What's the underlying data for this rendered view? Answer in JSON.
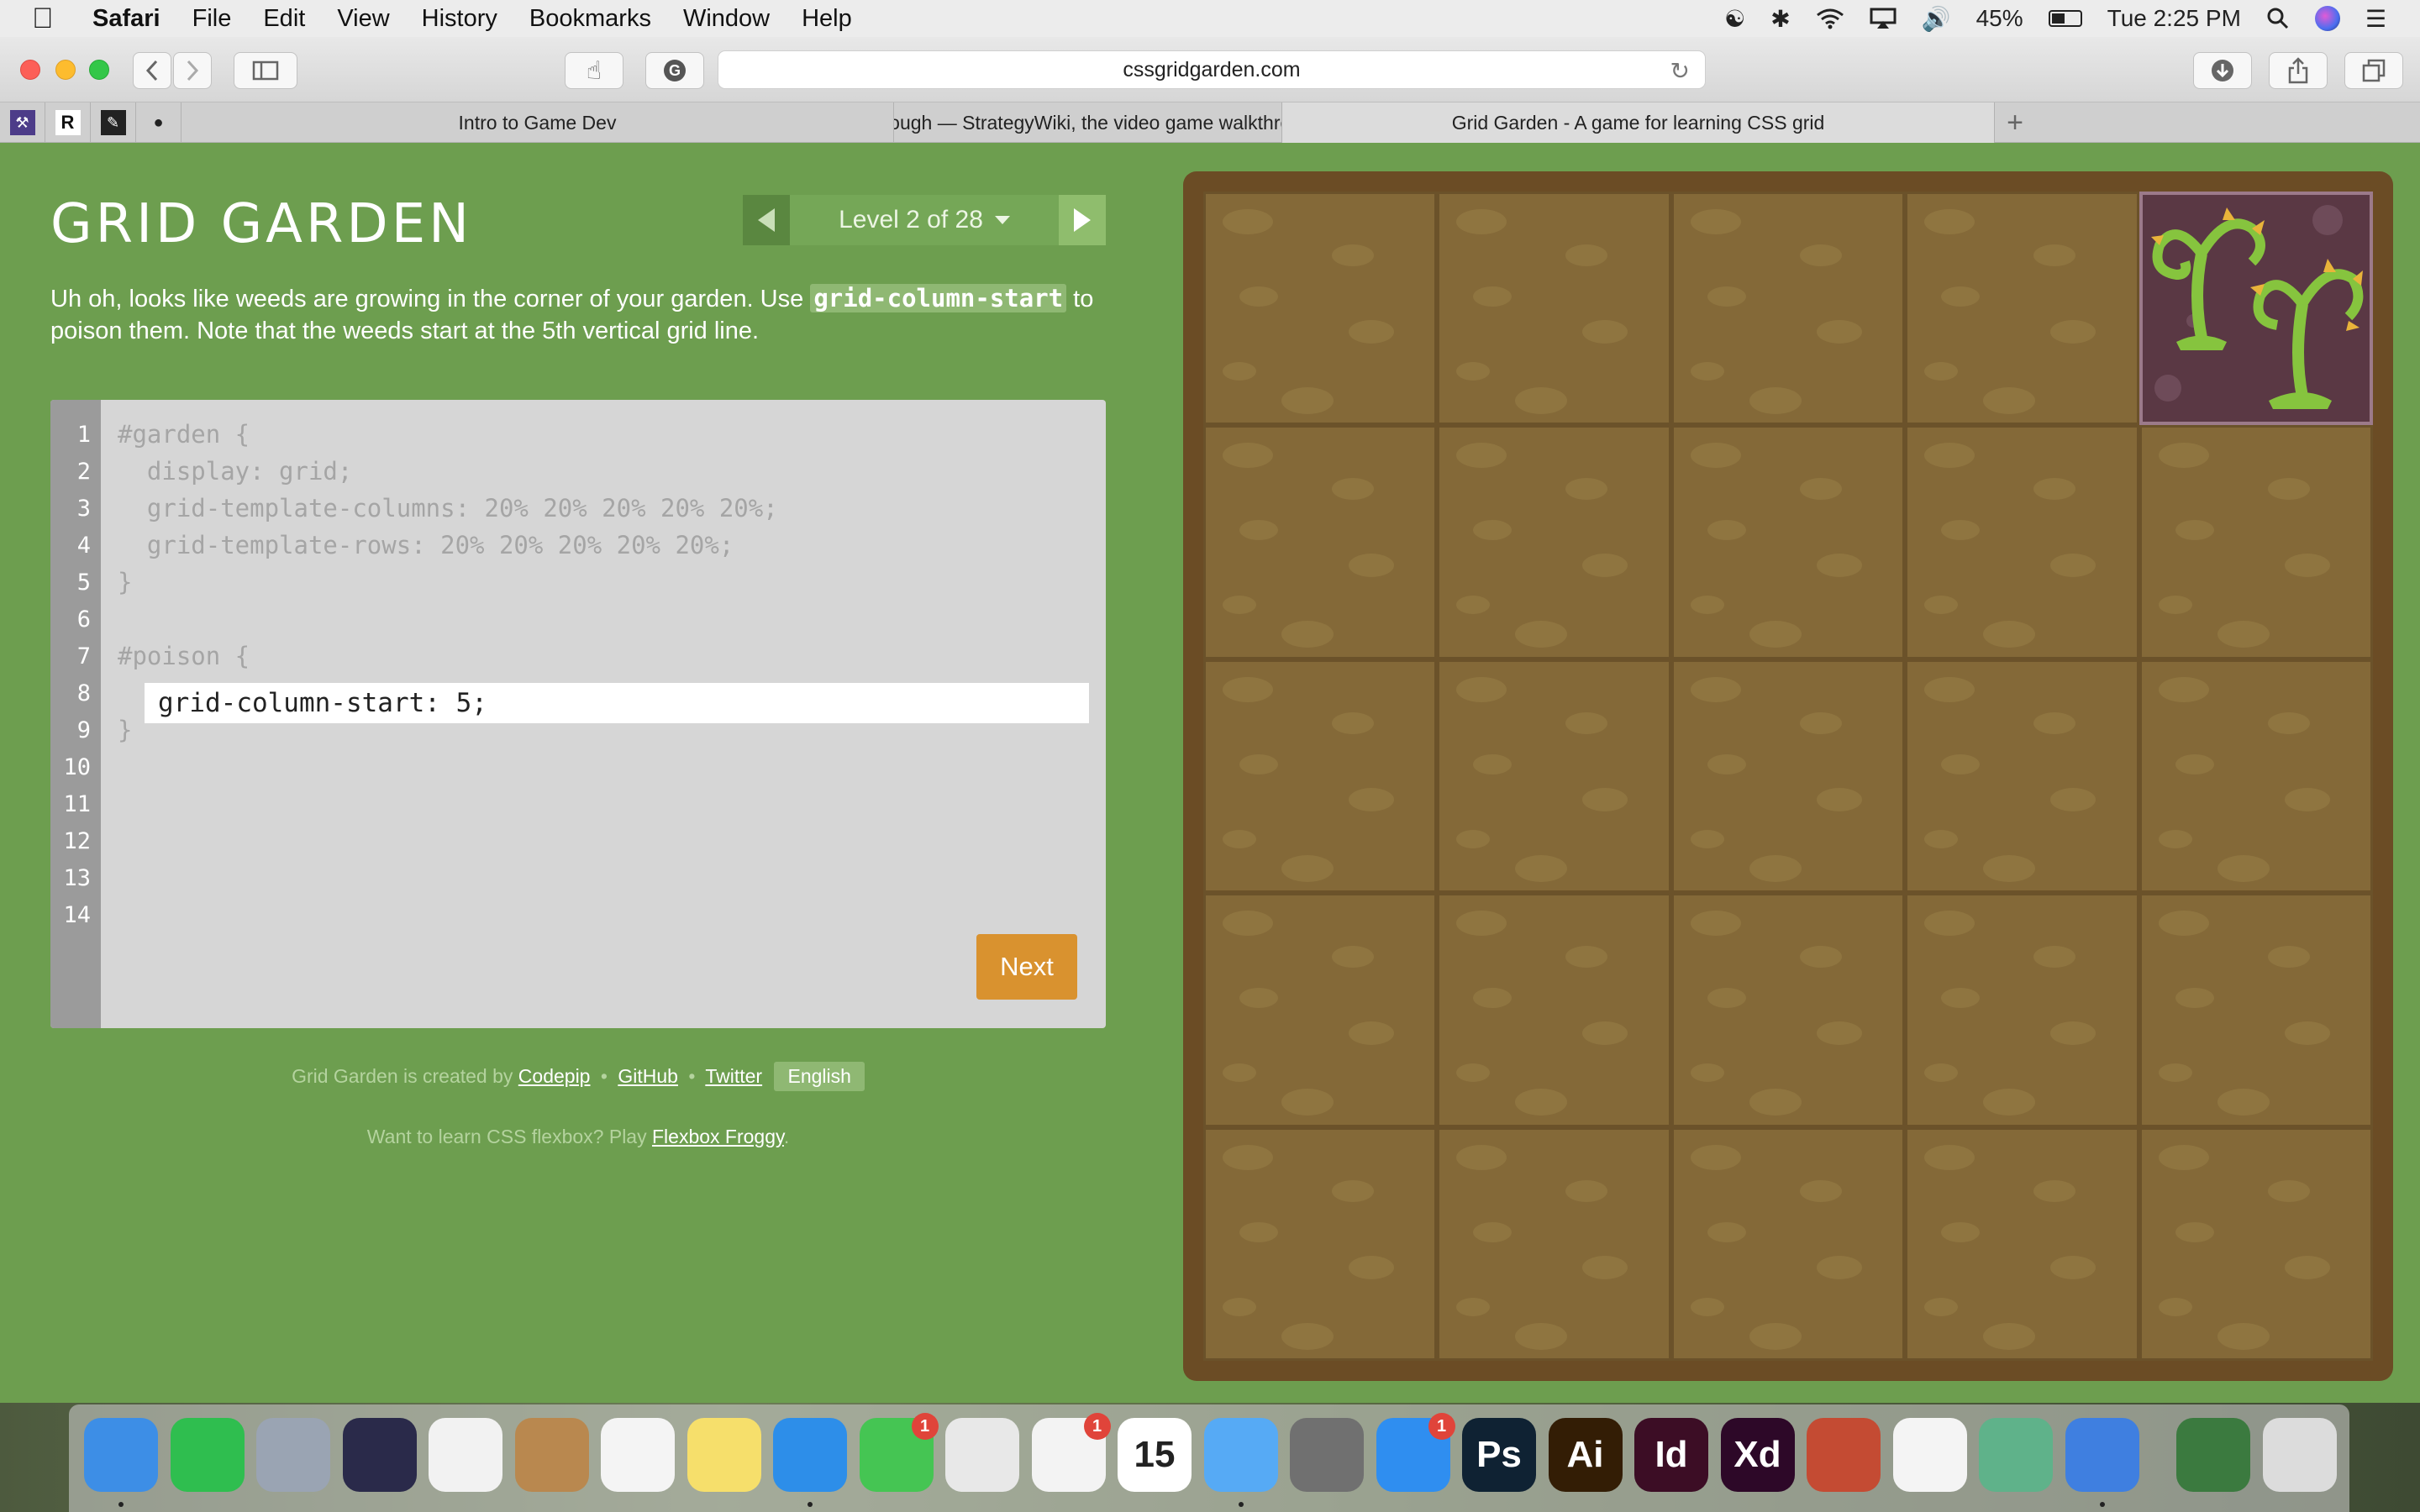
{
  "menubar": {
    "app": "Safari",
    "items": [
      "File",
      "Edit",
      "View",
      "History",
      "Bookmarks",
      "Window",
      "Help"
    ],
    "battery": "45%",
    "clock": "Tue 2:25 PM"
  },
  "browser": {
    "url": "cssgridgarden.com",
    "tabs": [
      {
        "title": "Intro to Game Dev",
        "active": false
      },
      {
        "title": "Joust/Walkthrough — StrategyWiki, the video game walkthrough and str...",
        "active": false
      },
      {
        "title": "Grid Garden - A game for learning CSS grid",
        "active": true
      }
    ],
    "pinned_tabs": [
      "pinned-tab-purple-icon",
      "pinned-tab-r-icon",
      "pinned-tab-d-icon",
      "pinned-tab-hat-icon"
    ],
    "pinned_r_label": "R"
  },
  "game": {
    "title": "GRID GARDEN",
    "level_label": "Level 2 of 28",
    "instructions": {
      "before": "Uh oh, looks like weeds are growing in the corner of your garden. Use ",
      "code": "grid-column-start",
      "after": " to poison them. Note that the weeds start at the 5th vertical grid line."
    },
    "line_numbers": [
      "1",
      "2",
      "3",
      "4",
      "5",
      "6",
      "7",
      "8",
      "9",
      "10",
      "11",
      "12",
      "13",
      "14"
    ],
    "code_lines": {
      "l1": "#garden {",
      "l2": "  display: grid;",
      "l3": "  grid-template-columns: 20% 20% 20% 20% 20%;",
      "l4": "  grid-template-rows: 20% 20% 20% 20% 20%;",
      "l5": "}",
      "l7": "#poison {",
      "l9": "}"
    },
    "input_value": "grid-column-start: 5;",
    "next_label": "Next",
    "credits": {
      "prefix": "Grid Garden is created by ",
      "codepip": "Codepip",
      "sep": "•",
      "github": "GitHub",
      "twitter": "Twitter",
      "language": "English"
    },
    "froggy": {
      "prefix": "Want to learn CSS flexbox? Play ",
      "link": "Flexbox Froggy",
      "suffix": "."
    },
    "grid": {
      "columns": 5,
      "rows": 5,
      "weed_column": 5,
      "weed_row": 1
    }
  },
  "dock": {
    "apps": [
      {
        "name": "finder-icon",
        "label": "",
        "color": "#3d8ee6"
      },
      {
        "name": "whatsapp-icon",
        "label": "",
        "color": "#2fbe4f"
      },
      {
        "name": "launchpad-icon",
        "label": "",
        "color": "#9aa4b3"
      },
      {
        "name": "siri-icon",
        "label": "",
        "color": "#2a2a4a"
      },
      {
        "name": "itunes-icon",
        "label": "",
        "color": "#f2f2f2"
      },
      {
        "name": "contacts-icon",
        "label": "",
        "color": "#b9884f"
      },
      {
        "name": "calendar-icon",
        "label": "",
        "color": "#f4f4f4"
      },
      {
        "name": "notes-icon",
        "label": "",
        "color": "#f6df6b"
      },
      {
        "name": "safari-icon",
        "label": "",
        "color": "#2d8ee9"
      },
      {
        "name": "facetime-icon",
        "label": "",
        "color": "#45c553",
        "badge": "1"
      },
      {
        "name": "chrome-icon",
        "label": "",
        "color": "#e8e8e8"
      },
      {
        "name": "photos-icon",
        "label": "",
        "color": "#f3f3f3",
        "badge": "1"
      },
      {
        "name": "calendar-date-icon",
        "label": "15",
        "color": "#ffffff"
      },
      {
        "name": "messages-icon",
        "label": "",
        "color": "#56aaf5"
      },
      {
        "name": "system-preferences-icon",
        "label": "",
        "color": "#707070"
      },
      {
        "name": "app-store-icon",
        "label": "",
        "color": "#2f8ef0",
        "badge": "1"
      },
      {
        "name": "photoshop-icon",
        "label": "Ps",
        "color": "#0f2233"
      },
      {
        "name": "illustrator-icon",
        "label": "Ai",
        "color": "#331d05"
      },
      {
        "name": "indesign-icon",
        "label": "Id",
        "color": "#3c0d25"
      },
      {
        "name": "xd-icon",
        "label": "Xd",
        "color": "#2d0828"
      },
      {
        "name": "sketchup-icon",
        "label": "",
        "color": "#c44b33"
      },
      {
        "name": "gamemaker-icon",
        "label": "",
        "color": "#f4f4f4"
      },
      {
        "name": "atom-icon",
        "label": "",
        "color": "#5fb28a"
      },
      {
        "name": "chrome-canary-icon",
        "label": "",
        "color": "#3f7fe0"
      },
      {
        "name": "utility-app-icon",
        "label": "",
        "color": "#3b7a3f"
      },
      {
        "name": "trash-icon",
        "label": "",
        "color": "#dcdcdc"
      }
    ]
  }
}
